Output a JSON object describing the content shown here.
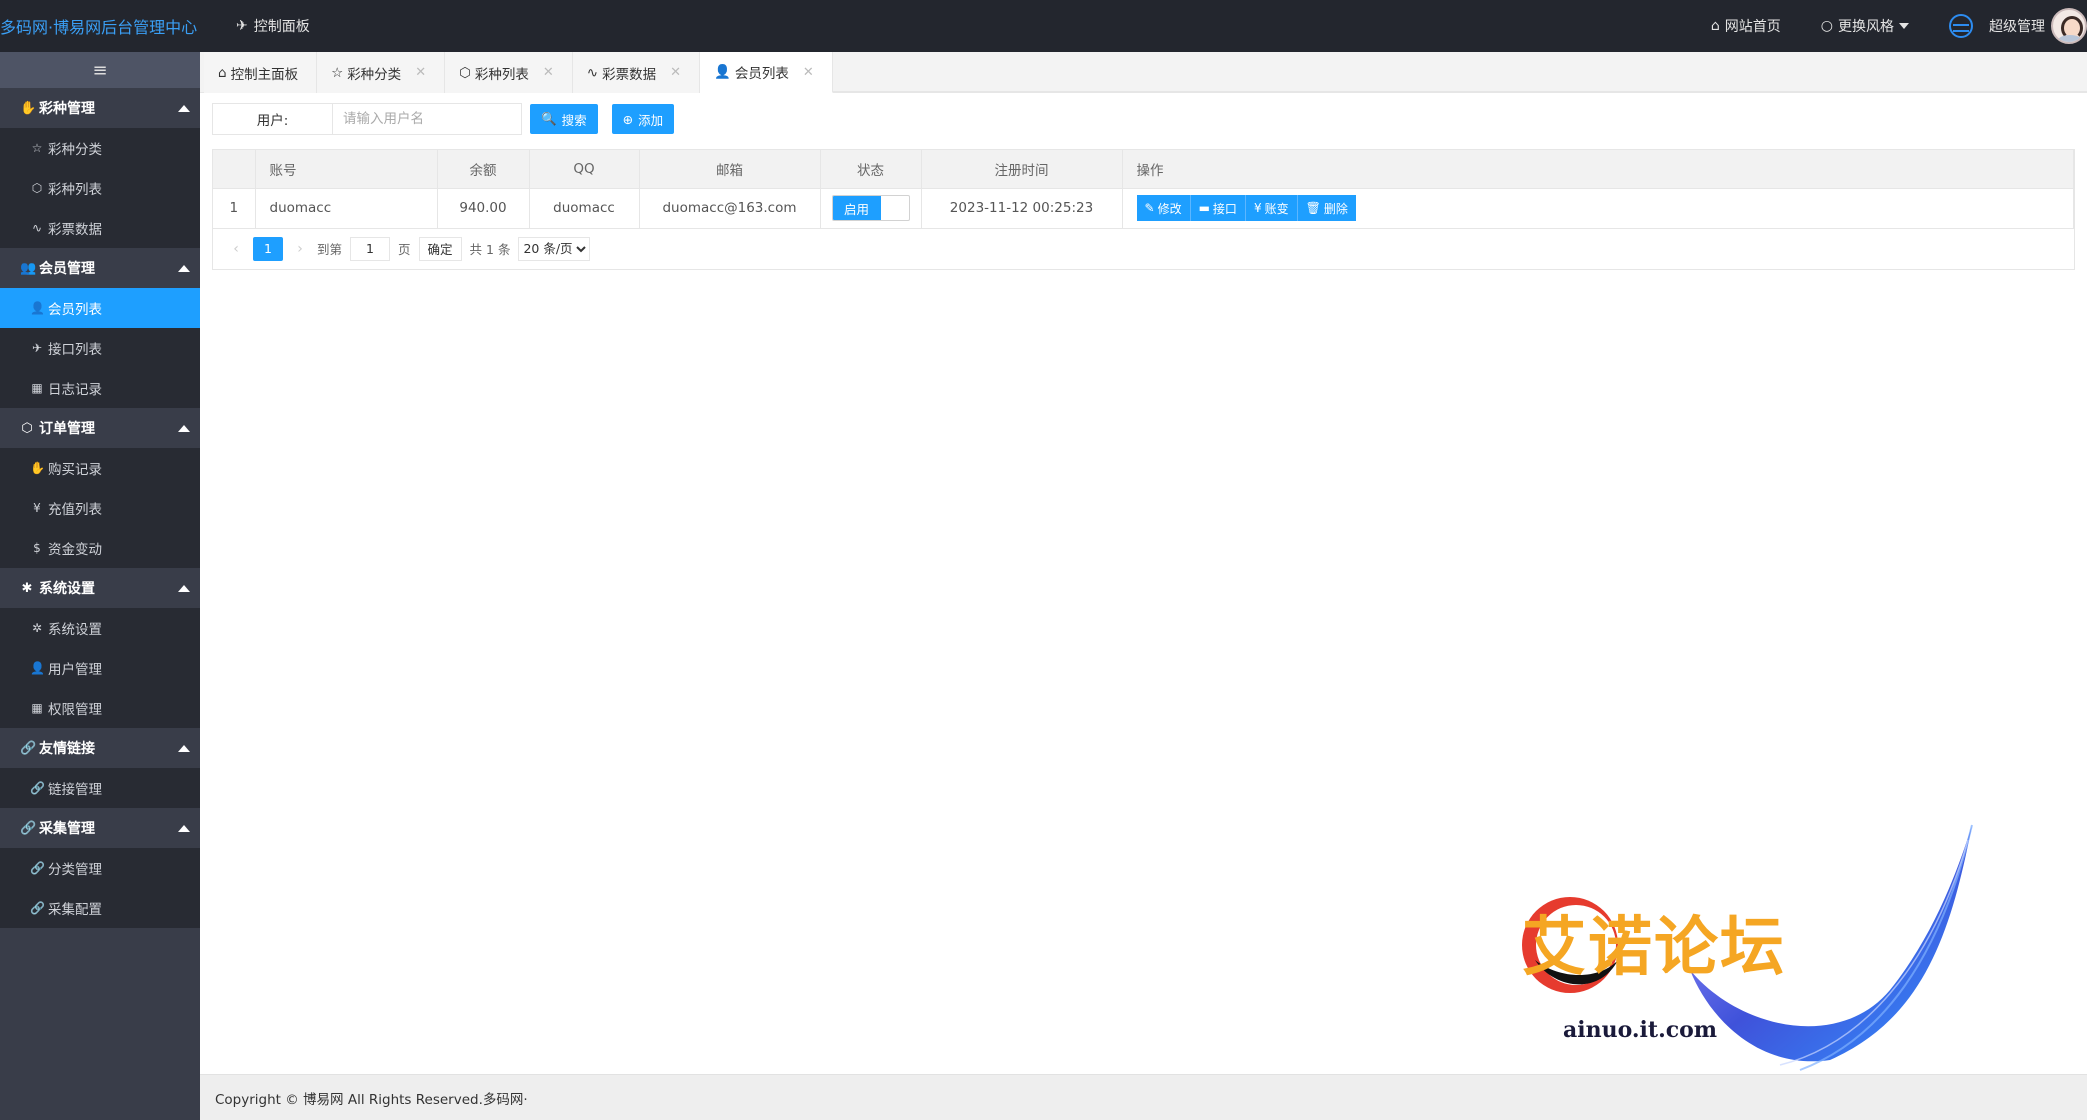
{
  "header": {
    "brand": "多码网·博易网后台管理中心",
    "nav_label": "控制面板",
    "site_home": "网站首页",
    "theme": "更换风格",
    "user": "超级管理"
  },
  "sidebar": {
    "toggle": "≡",
    "groups": [
      {
        "label": "彩种管理",
        "items": [
          {
            "label": "彩种分类"
          },
          {
            "label": "彩种列表"
          },
          {
            "label": "彩票数据"
          }
        ]
      },
      {
        "label": "会员管理",
        "items": [
          {
            "label": "会员列表",
            "active": true
          },
          {
            "label": "接口列表"
          },
          {
            "label": "日志记录"
          }
        ]
      },
      {
        "label": "订单管理",
        "items": [
          {
            "label": "购买记录"
          },
          {
            "label": "充值列表"
          },
          {
            "label": "资金变动"
          }
        ]
      },
      {
        "label": "系统设置",
        "items": [
          {
            "label": "系统设置"
          },
          {
            "label": "用户管理"
          },
          {
            "label": "权限管理"
          }
        ]
      },
      {
        "label": "友情链接",
        "items": [
          {
            "label": "链接管理"
          }
        ]
      },
      {
        "label": "采集管理",
        "items": [
          {
            "label": "分类管理"
          },
          {
            "label": "采集配置"
          }
        ]
      }
    ]
  },
  "tabs": [
    {
      "label": "控制主面板"
    },
    {
      "label": "彩种分类"
    },
    {
      "label": "彩种列表"
    },
    {
      "label": "彩票数据"
    },
    {
      "label": "会员列表",
      "active": true
    }
  ],
  "search": {
    "label": "用户:",
    "placeholder": "请输入用户名",
    "search_btn": "搜索",
    "add_btn": "添加"
  },
  "table": {
    "columns": [
      "",
      "账号",
      "余额",
      "QQ",
      "邮箱",
      "状态",
      "注册时间",
      "操作"
    ],
    "rows": [
      {
        "index": "1",
        "account": "duomacc",
        "balance": "940.00",
        "qq": "duomacc",
        "email": "duomacc@163.com",
        "status": "启用",
        "registered": "2023-11-12 00:25:23"
      }
    ],
    "actions": [
      "修改",
      "接口",
      "账变",
      "删除"
    ]
  },
  "pagination": {
    "current": "1",
    "goto_label": "到第",
    "goto_value": "1",
    "page_unit": "页",
    "confirm": "确定",
    "total": "共 1 条",
    "page_size": "20 条/页"
  },
  "footer": {
    "copyright": "Copyright © 博易网 All Rights Reserved.多码网·"
  },
  "watermark": {
    "title": "艾诺论坛",
    "url": "ainuo.it.com"
  },
  "colors": {
    "header_bg": "#23262e",
    "sidebar_bg": "#393d49",
    "sidebar_sub_bg": "#282b33",
    "accent": "#1e9fff"
  }
}
